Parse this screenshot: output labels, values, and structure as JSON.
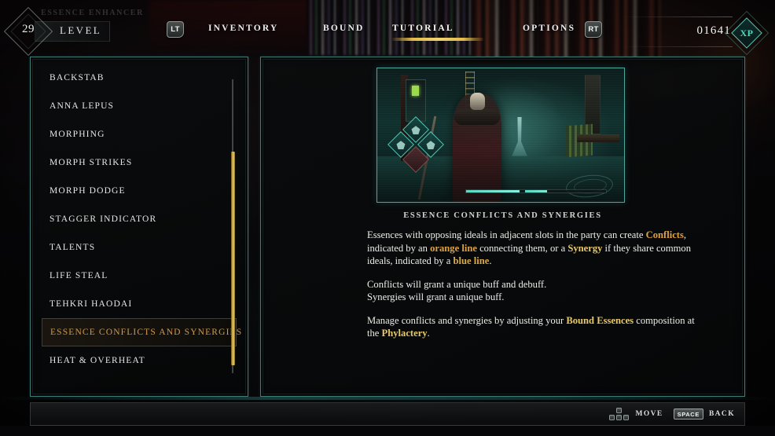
{
  "header": {
    "game_title": "ESSENCE ENHANCER",
    "level_label": "LEVEL",
    "level_value": "29",
    "left_trigger": "LT",
    "right_trigger": "RT",
    "xp_value": "01641",
    "xp_badge": "XP",
    "tabs": [
      {
        "label": "INVENTORY",
        "active": false
      },
      {
        "label": "BOUND",
        "active": false
      },
      {
        "label": "TUTORIAL",
        "active": true
      },
      {
        "label": "OPTIONS",
        "active": false
      }
    ],
    "accent_color": "#e3bb4a"
  },
  "sidebar": {
    "items": [
      {
        "label": "BACKSTAB",
        "selected": false
      },
      {
        "label": "ANNA LEPUS",
        "selected": false
      },
      {
        "label": "MORPHING",
        "selected": false
      },
      {
        "label": "MORPH STRIKES",
        "selected": false
      },
      {
        "label": "MORPH DODGE",
        "selected": false
      },
      {
        "label": "STAGGER INDICATOR",
        "selected": false
      },
      {
        "label": "TALENTS",
        "selected": false
      },
      {
        "label": "LIFE STEAL",
        "selected": false
      },
      {
        "label": "TEHKRI HAODAI",
        "selected": false
      },
      {
        "label": "ESSENCE CONFLICTS AND SYNERGIES",
        "selected": true
      },
      {
        "label": "HEAT & OVERHEAT",
        "selected": false
      }
    ],
    "selected_color": "#cf9a4e",
    "scrollbar_color": "#d8b44a"
  },
  "content": {
    "title": "ESSENCE CONFLICTS AND SYNERGIES",
    "image_alt": "tutorial-screenshot-essence-slots",
    "paragraphs": [
      {
        "runs": [
          {
            "text": "Essences with opposing ideals in adjacent slots in the party can create ",
            "style": "normal"
          },
          {
            "text": "Conflicts",
            "style": "orange"
          },
          {
            "text": ", indicated by an ",
            "style": "normal"
          },
          {
            "text": "orange line",
            "style": "orange"
          },
          {
            "text": " connecting them, or a ",
            "style": "normal"
          },
          {
            "text": "Synergy",
            "style": "gold"
          },
          {
            "text": " if they share common ideals, indicated by a ",
            "style": "normal"
          },
          {
            "text": "blue line",
            "style": "blue"
          },
          {
            "text": ".",
            "style": "normal"
          }
        ]
      },
      {
        "runs": [
          {
            "text": "Conflicts will grant a unique buff and debuff.",
            "style": "normal"
          },
          {
            "text": "\n",
            "style": "break"
          },
          {
            "text": "Synergies will grant a unique buff.",
            "style": "normal"
          }
        ]
      },
      {
        "runs": [
          {
            "text": "Manage conflicts and synergies by adjusting your ",
            "style": "normal"
          },
          {
            "text": "Bound Essences",
            "style": "gold"
          },
          {
            "text": " composition at the ",
            "style": "normal"
          },
          {
            "text": "Phylactery",
            "style": "gold"
          },
          {
            "text": ".",
            "style": "normal"
          }
        ]
      }
    ]
  },
  "footer": {
    "hints": [
      {
        "key": "arrow-keys",
        "label": "MOVE"
      },
      {
        "key": "SPACE",
        "label": "BACK"
      }
    ]
  },
  "theme": {
    "panel_border": "#3f7d79",
    "text": "#eceee9",
    "orange": "#e0a23f",
    "gold": "#e8c96a"
  }
}
